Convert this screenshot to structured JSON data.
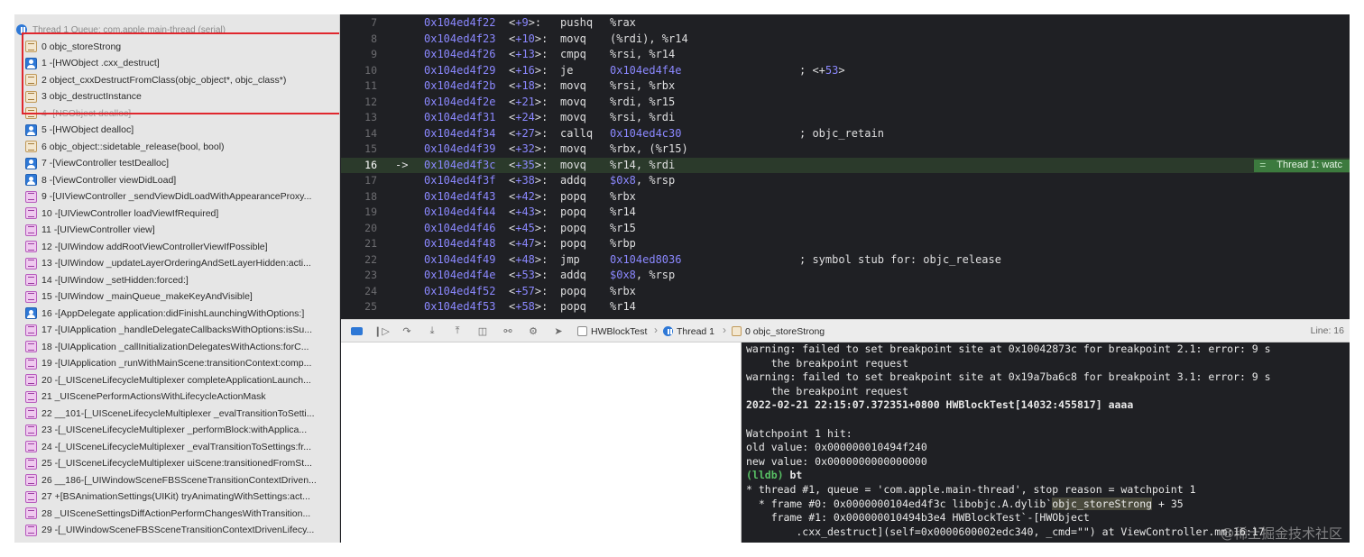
{
  "navigator": {
    "thread_header": "Thread 1 Queue: com.apple.main-thread (serial)",
    "frames": [
      {
        "label": "0 objc_storeStrong",
        "icon": "library-icon"
      },
      {
        "label": "1 -[HWObject .cxx_destruct]",
        "icon": "user-code-icon"
      },
      {
        "label": "2 object_cxxDestructFromClass(objc_object*, objc_class*)",
        "icon": "library-icon"
      },
      {
        "label": "3 objc_destructInstance",
        "icon": "library-icon"
      },
      {
        "label": "4 -[NSObject dealloc]",
        "icon": "library-icon"
      },
      {
        "label": "5 -[HWObject dealloc]",
        "icon": "user-code-icon"
      },
      {
        "label": "6 objc_object::sidetable_release(bool, bool)",
        "icon": "library-icon"
      },
      {
        "label": "7 -[ViewController testDealloc]",
        "icon": "user-code-icon"
      },
      {
        "label": "8 -[ViewController viewDidLoad]",
        "icon": "user-code-icon"
      },
      {
        "label": "9 -[UIViewController _sendViewDidLoadWithAppearanceProxy...",
        "icon": "system-framework-icon"
      },
      {
        "label": "10 -[UIViewController loadViewIfRequired]",
        "icon": "system-framework-icon"
      },
      {
        "label": "11 -[UIViewController view]",
        "icon": "system-framework-icon"
      },
      {
        "label": "12 -[UIWindow addRootViewControllerViewIfPossible]",
        "icon": "system-framework-icon"
      },
      {
        "label": "13 -[UIWindow _updateLayerOrderingAndSetLayerHidden:acti...",
        "icon": "system-framework-icon"
      },
      {
        "label": "14 -[UIWindow _setHidden:forced:]",
        "icon": "system-framework-icon"
      },
      {
        "label": "15 -[UIWindow _mainQueue_makeKeyAndVisible]",
        "icon": "system-framework-icon"
      },
      {
        "label": "16 -[AppDelegate application:didFinishLaunchingWithOptions:]",
        "icon": "user-code-icon"
      },
      {
        "label": "17 -[UIApplication _handleDelegateCallbacksWithOptions:isSu...",
        "icon": "system-framework-icon"
      },
      {
        "label": "18 -[UIApplication _callInitializationDelegatesWithActions:forC...",
        "icon": "system-framework-icon"
      },
      {
        "label": "19 -[UIApplication _runWithMainScene:transitionContext:comp...",
        "icon": "system-framework-icon"
      },
      {
        "label": "20 -[_UISceneLifecycleMultiplexer completeApplicationLaunch...",
        "icon": "system-framework-icon"
      },
      {
        "label": "21 _UIScenePerformActionsWithLifecycleActionMask",
        "icon": "system-framework-icon"
      },
      {
        "label": "22 __101-[_UISceneLifecycleMultiplexer _evalTransitionToSetti...",
        "icon": "system-framework-icon"
      },
      {
        "label": "23 -[_UISceneLifecycleMultiplexer _performBlock:withApplica...",
        "icon": "system-framework-icon"
      },
      {
        "label": "24 -[_UISceneLifecycleMultiplexer _evalTransitionToSettings:fr...",
        "icon": "system-framework-icon"
      },
      {
        "label": "25 -[_UISceneLifecycleMultiplexer uiScene:transitionedFromSt...",
        "icon": "system-framework-icon"
      },
      {
        "label": "26 __186-[_UIWindowSceneFBSSceneTransitionContextDriven...",
        "icon": "system-framework-icon"
      },
      {
        "label": "27 +[BSAnimationSettings(UIKit) tryAnimatingWithSettings:act...",
        "icon": "system-framework-icon"
      },
      {
        "label": "28 _UISceneSettingsDiffActionPerformChangesWithTransition...",
        "icon": "system-framework-icon"
      },
      {
        "label": "29 -[_UIWindowSceneFBSSceneTransitionContextDrivenLifecy...",
        "icon": "system-framework-icon"
      }
    ]
  },
  "disassembly": {
    "lines": [
      {
        "ln": "7",
        "addr": "0x104ed4f22",
        "off": "+9",
        "mn": "pushq",
        "ops": "%rax",
        "cm": ""
      },
      {
        "ln": "8",
        "addr": "0x104ed4f23",
        "off": "+10",
        "mn": "movq",
        "ops": "(%rdi), %r14",
        "cm": ""
      },
      {
        "ln": "9",
        "addr": "0x104ed4f26",
        "off": "+13",
        "mn": "cmpq",
        "ops": "%rsi, %r14",
        "cm": ""
      },
      {
        "ln": "10",
        "addr": "0x104ed4f29",
        "off": "+16",
        "mn": "je",
        "ops": "0x104ed4f4e",
        "cm": "; <+53>"
      },
      {
        "ln": "11",
        "addr": "0x104ed4f2b",
        "off": "+18",
        "mn": "movq",
        "ops": "%rsi, %rbx",
        "cm": ""
      },
      {
        "ln": "12",
        "addr": "0x104ed4f2e",
        "off": "+21",
        "mn": "movq",
        "ops": "%rdi, %r15",
        "cm": ""
      },
      {
        "ln": "13",
        "addr": "0x104ed4f31",
        "off": "+24",
        "mn": "movq",
        "ops": "%rsi, %rdi",
        "cm": ""
      },
      {
        "ln": "14",
        "addr": "0x104ed4f34",
        "off": "+27",
        "mn": "callq",
        "ops": "0x104ed4c30",
        "cm": "; objc_retain"
      },
      {
        "ln": "15",
        "addr": "0x104ed4f39",
        "off": "+32",
        "mn": "movq",
        "ops": "%rbx, (%r15)",
        "cm": ""
      },
      {
        "ln": "16",
        "addr": "0x104ed4f3c",
        "off": "+35",
        "mn": "movq",
        "ops": "%r14, %rdi",
        "cm": "",
        "current": true,
        "arrow": "->"
      },
      {
        "ln": "17",
        "addr": "0x104ed4f3f",
        "off": "+38",
        "mn": "addq",
        "ops": "$0x8, %rsp",
        "cm": ""
      },
      {
        "ln": "18",
        "addr": "0x104ed4f43",
        "off": "+42",
        "mn": "popq",
        "ops": "%rbx",
        "cm": ""
      },
      {
        "ln": "19",
        "addr": "0x104ed4f44",
        "off": "+43",
        "mn": "popq",
        "ops": "%r14",
        "cm": ""
      },
      {
        "ln": "20",
        "addr": "0x104ed4f46",
        "off": "+45",
        "mn": "popq",
        "ops": "%r15",
        "cm": ""
      },
      {
        "ln": "21",
        "addr": "0x104ed4f48",
        "off": "+47",
        "mn": "popq",
        "ops": "%rbp",
        "cm": ""
      },
      {
        "ln": "22",
        "addr": "0x104ed4f49",
        "off": "+48",
        "mn": "jmp",
        "ops": "0x104ed8036",
        "cm": "; symbol stub for: objc_release"
      },
      {
        "ln": "23",
        "addr": "0x104ed4f4e",
        "off": "+53",
        "mn": "addq",
        "ops": "$0x8, %rsp",
        "cm": ""
      },
      {
        "ln": "24",
        "addr": "0x104ed4f52",
        "off": "+57",
        "mn": "popq",
        "ops": "%rbx",
        "cm": ""
      },
      {
        "ln": "25",
        "addr": "0x104ed4f53",
        "off": "+58",
        "mn": "popq",
        "ops": "%r14",
        "cm": ""
      }
    ],
    "thread_badge": "Thread 1: watc"
  },
  "debug_bar": {
    "crumbs": [
      "HWBlockTest",
      "Thread 1",
      "0 objc_storeStrong"
    ],
    "line_indicator": "Line: 16"
  },
  "console": {
    "lines": [
      {
        "text": "warning: failed to set breakpoint site at 0x10042873c for breakpoint 2.1: error: 9 s"
      },
      {
        "text": "    the breakpoint request"
      },
      {
        "text": "warning: failed to set breakpoint site at 0x19a7ba6c8 for breakpoint 3.1: error: 9 s"
      },
      {
        "text": "    the breakpoint request"
      },
      {
        "text": "2022-02-21 22:15:07.372351+0800 HWBlockTest[14032:455817] aaaa",
        "bold": true
      },
      {
        "text": ""
      },
      {
        "text": "Watchpoint 1 hit:"
      },
      {
        "text": "old value: 0x000000010494f240"
      },
      {
        "text": "new value: 0x0000000000000000"
      },
      {
        "prompt": "(lldb)",
        "text": " bt",
        "bold": true
      },
      {
        "text": "* thread #1, queue = 'com.apple.main-thread', stop reason = watchpoint 1"
      },
      {
        "pre": "  * frame #0: 0x0000000104ed4f3c libobjc.A.dylib`",
        "hl": "objc_storeStrong",
        "post": " + 35"
      },
      {
        "text": "    frame #1: 0x000000010494b3e4 HWBlockTest`-[HWObject"
      },
      {
        "text": "        .cxx_destruct](self=0x0000600002edc340, _cmd=\"\") at ViewController.mm:16:17"
      }
    ],
    "watermark": "@稀土掘金技术社区"
  }
}
